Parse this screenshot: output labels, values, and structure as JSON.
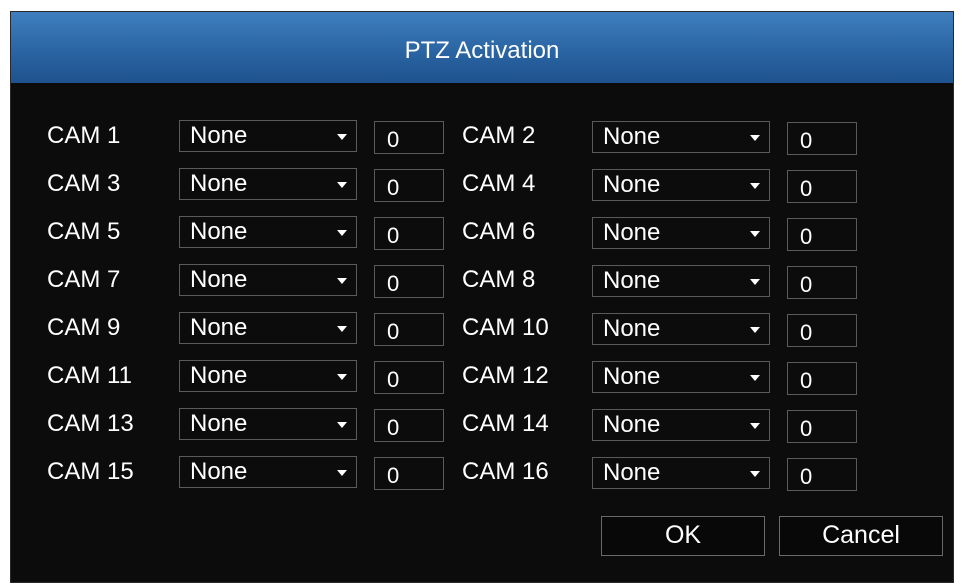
{
  "dialog": {
    "title": "PTZ Activation"
  },
  "cameras": [
    {
      "label": "CAM 1",
      "mode": "None",
      "value": "0"
    },
    {
      "label": "CAM 2",
      "mode": "None",
      "value": "0"
    },
    {
      "label": "CAM 3",
      "mode": "None",
      "value": "0"
    },
    {
      "label": "CAM 4",
      "mode": "None",
      "value": "0"
    },
    {
      "label": "CAM 5",
      "mode": "None",
      "value": "0"
    },
    {
      "label": "CAM 6",
      "mode": "None",
      "value": "0"
    },
    {
      "label": "CAM 7",
      "mode": "None",
      "value": "0"
    },
    {
      "label": "CAM 8",
      "mode": "None",
      "value": "0"
    },
    {
      "label": "CAM 9",
      "mode": "None",
      "value": "0"
    },
    {
      "label": "CAM 10",
      "mode": "None",
      "value": "0"
    },
    {
      "label": "CAM 11",
      "mode": "None",
      "value": "0"
    },
    {
      "label": "CAM 12",
      "mode": "None",
      "value": "0"
    },
    {
      "label": "CAM 13",
      "mode": "None",
      "value": "0"
    },
    {
      "label": "CAM 14",
      "mode": "None",
      "value": "0"
    },
    {
      "label": "CAM 15",
      "mode": "None",
      "value": "0"
    },
    {
      "label": "CAM 16",
      "mode": "None",
      "value": "0"
    }
  ],
  "buttons": {
    "ok": "OK",
    "cancel": "Cancel"
  },
  "colors": {
    "titlebar": "#2e69a8",
    "background": "#0c0c0c",
    "text": "#ffffff"
  }
}
